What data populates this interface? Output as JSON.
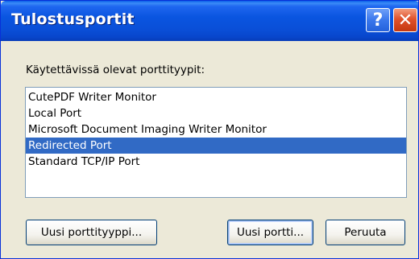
{
  "window": {
    "title": "Tulostusportit",
    "help_glyph": "?",
    "close_glyph": "✕"
  },
  "colors": {
    "titlebar": "#0a55e0",
    "dialog_bg": "#ece9d8",
    "selection": "#316ac5",
    "list_border": "#7f9db9"
  },
  "port_types": {
    "label": "Käytettävissä olevat porttityypit:",
    "items": [
      "CutePDF Writer Monitor",
      "Local Port",
      "Microsoft Document Imaging Writer Monitor",
      "Redirected Port",
      "Standard TCP/IP Port"
    ],
    "selected": "Redirected Port"
  },
  "buttons": {
    "new_port_type": "Uusi porttityyppi...",
    "new_port": "Uusi portti...",
    "cancel": "Peruuta"
  }
}
